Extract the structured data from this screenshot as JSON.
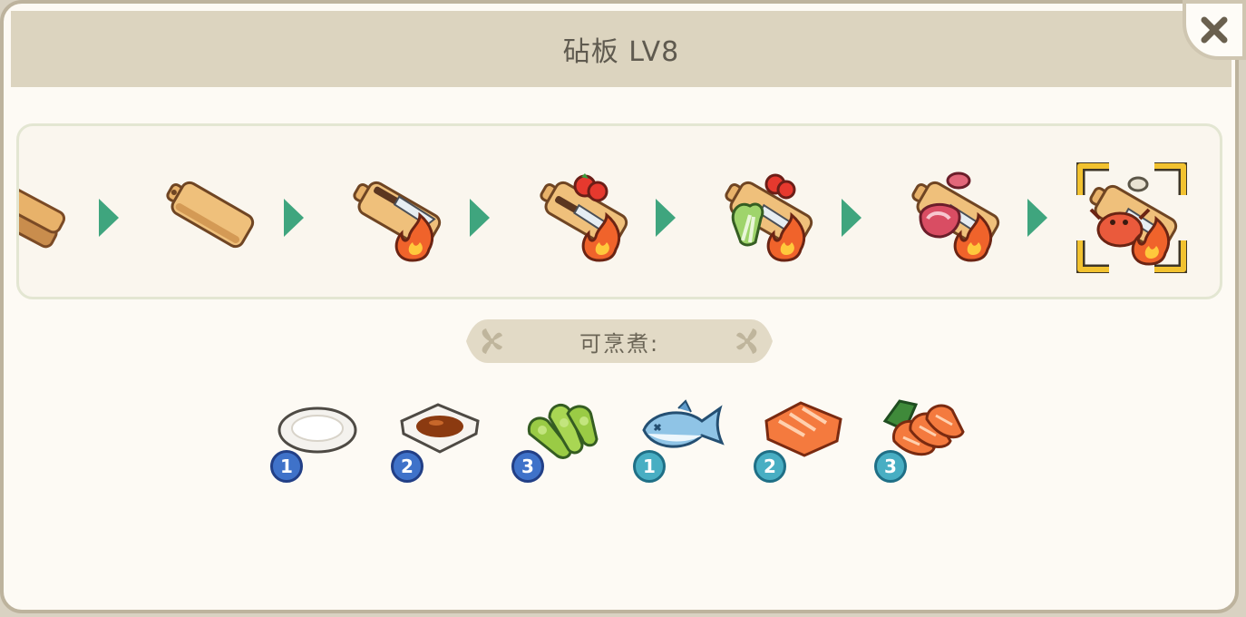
{
  "title": "砧板 LV8",
  "close_button": {
    "icon": "close-icon"
  },
  "upgrade_stages": [
    {
      "name": "stacked-boards"
    },
    {
      "name": "plain-board"
    },
    {
      "name": "board-knife-fire"
    },
    {
      "name": "board-knife-tomato-fire"
    },
    {
      "name": "board-tomato-cabbage-fire"
    },
    {
      "name": "board-meat-fire"
    },
    {
      "name": "board-crab-fire",
      "selected": true
    }
  ],
  "can_cook_label": "可烹煮:",
  "dishes": [
    {
      "name": "white-plate",
      "level": "1",
      "badge_color": "#3f72c9"
    },
    {
      "name": "soy-sauce-dish",
      "level": "2",
      "badge_color": "#3f72c9"
    },
    {
      "name": "edamame",
      "level": "3",
      "badge_color": "#3f72c9"
    },
    {
      "name": "fish",
      "level": "1",
      "badge_color": "#48aec3"
    },
    {
      "name": "salmon-fillet",
      "level": "2",
      "badge_color": "#48aec3"
    },
    {
      "name": "salmon-sashimi",
      "level": "3",
      "badge_color": "#48aec3"
    }
  ],
  "colors": {
    "panel": "#fdfaf4",
    "title_bar": "#dcd4bf",
    "arrow": "#3fa57e",
    "selection": "#f2c230",
    "wood": "#e7b56c",
    "fire": "#f0632b"
  }
}
